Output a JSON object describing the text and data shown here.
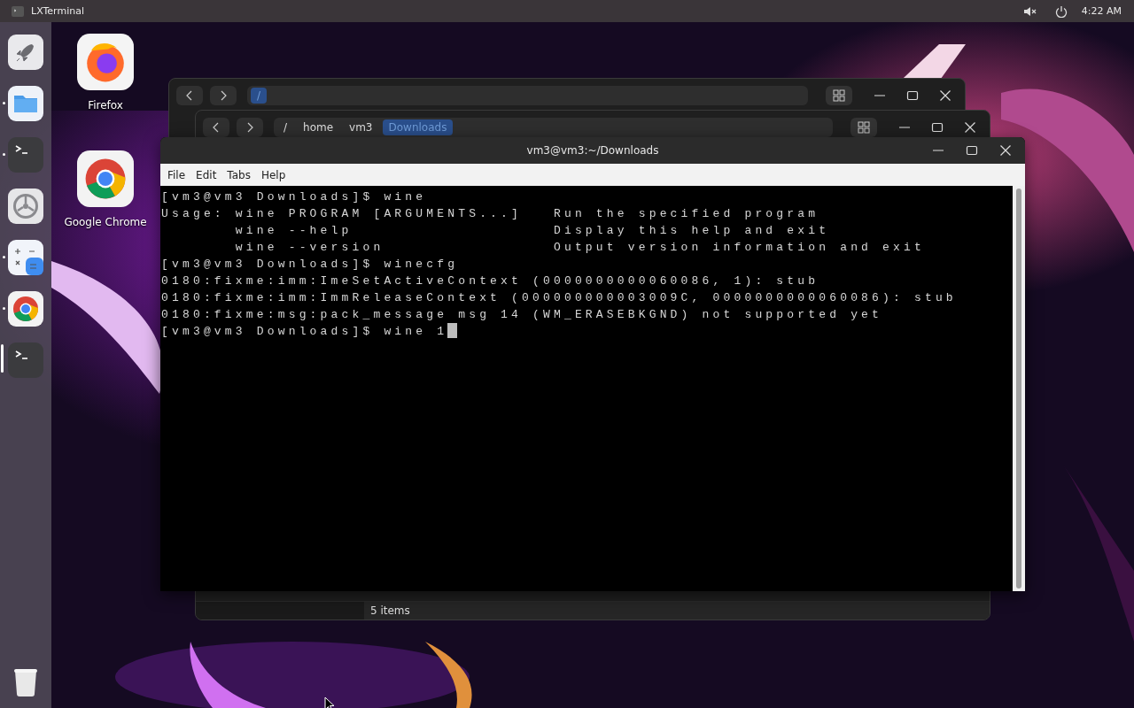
{
  "top_bar": {
    "app_title": "LXTerminal",
    "clock": "4:22 AM"
  },
  "dock": {
    "items": [
      {
        "kind": "launcher",
        "running": false,
        "focused": false
      },
      {
        "kind": "files",
        "running": true,
        "focused": false
      },
      {
        "kind": "terminal",
        "running": true,
        "focused": false
      },
      {
        "kind": "settings",
        "running": false,
        "focused": false
      },
      {
        "kind": "calculator",
        "running": true,
        "focused": false
      },
      {
        "kind": "chrome",
        "running": true,
        "focused": false
      },
      {
        "kind": "terminal",
        "running": false,
        "focused": true
      }
    ],
    "trash": {
      "kind": "trash"
    }
  },
  "desktop_icons": [
    {
      "label": "Firefox",
      "kind": "firefox"
    },
    {
      "label": "Google Chrome",
      "kind": "chrome"
    }
  ],
  "file_windows": [
    {
      "path": [
        {
          "label": "/",
          "selected": true
        }
      ]
    },
    {
      "path": [
        {
          "label": "/",
          "selected": false
        },
        {
          "label": "home",
          "selected": false
        },
        {
          "label": "vm3",
          "selected": false
        },
        {
          "label": "Downloads",
          "selected": true
        }
      ],
      "status": "5 items"
    }
  ],
  "terminal": {
    "title": "vm3@vm3:~/Downloads",
    "menu": [
      "File",
      "Edit",
      "Tabs",
      "Help"
    ],
    "lines": [
      "[vm3@vm3 Downloads]$ wine",
      "Usage: wine PROGRAM [ARGUMENTS...]   Run the specified program",
      "       wine --help                   Display this help and exit",
      "       wine --version                Output version information and exit",
      "[vm3@vm3 Downloads]$ winecfg",
      "0180:fixme:imm:ImeSetActiveContext (0000000000060086, 1): stub",
      "0180:fixme:imm:ImmReleaseContext (000000000003009C, 0000000000060086): stub",
      "0180:fixme:msg:pack_message msg 14 (WM_ERASEBKGND) not supported yet",
      "[vm3@vm3 Downloads]$ wine 1"
    ],
    "cursor": true
  }
}
